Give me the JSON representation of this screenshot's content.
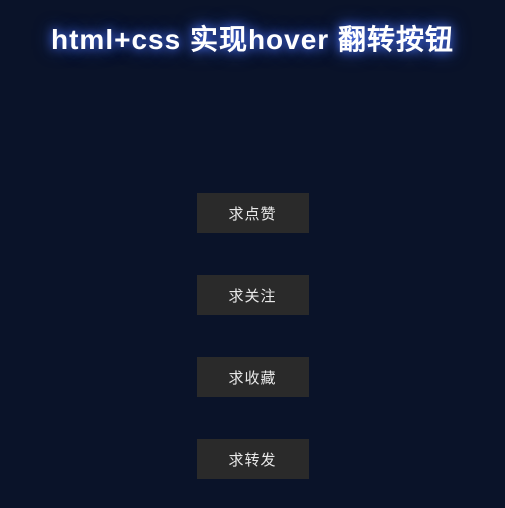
{
  "title": "html+css 实现hover 翻转按钮",
  "buttons": [
    {
      "label": "求点赞"
    },
    {
      "label": "求关注"
    },
    {
      "label": "求收藏"
    },
    {
      "label": "求转发"
    }
  ]
}
